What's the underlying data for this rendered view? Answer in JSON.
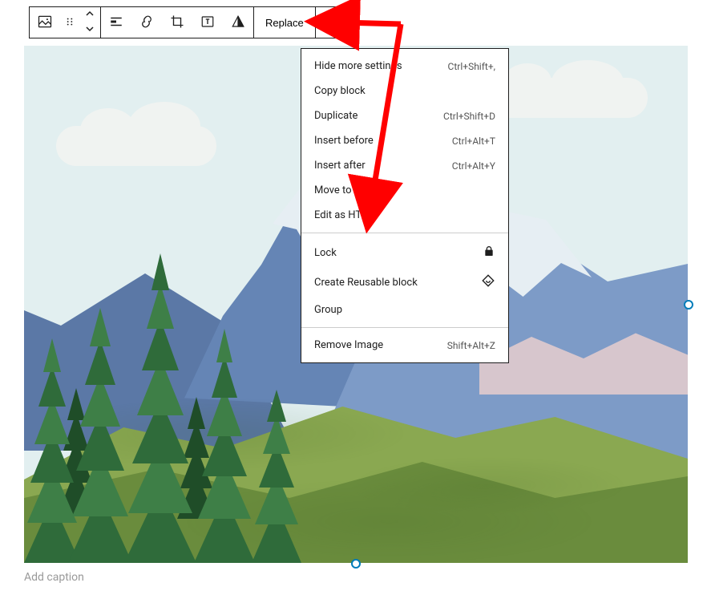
{
  "toolbar": {
    "replace_label": "Replace"
  },
  "menu": {
    "section1": [
      {
        "label": "Hide more settings",
        "shortcut": "Ctrl+Shift+,"
      },
      {
        "label": "Copy block",
        "shortcut": ""
      },
      {
        "label": "Duplicate",
        "shortcut": "Ctrl+Shift+D"
      },
      {
        "label": "Insert before",
        "shortcut": "Ctrl+Alt+T"
      },
      {
        "label": "Insert after",
        "shortcut": "Ctrl+Alt+Y"
      },
      {
        "label": "Move to",
        "shortcut": ""
      },
      {
        "label": "Edit as HTML",
        "shortcut": ""
      }
    ],
    "section2": [
      {
        "label": "Lock",
        "icon": "lock-icon"
      },
      {
        "label": "Create Reusable block",
        "icon": "reusable-icon"
      },
      {
        "label": "Group",
        "icon": ""
      }
    ],
    "section3": [
      {
        "label": "Remove Image",
        "shortcut": "Shift+Alt+Z"
      }
    ]
  },
  "caption_placeholder": "Add caption"
}
